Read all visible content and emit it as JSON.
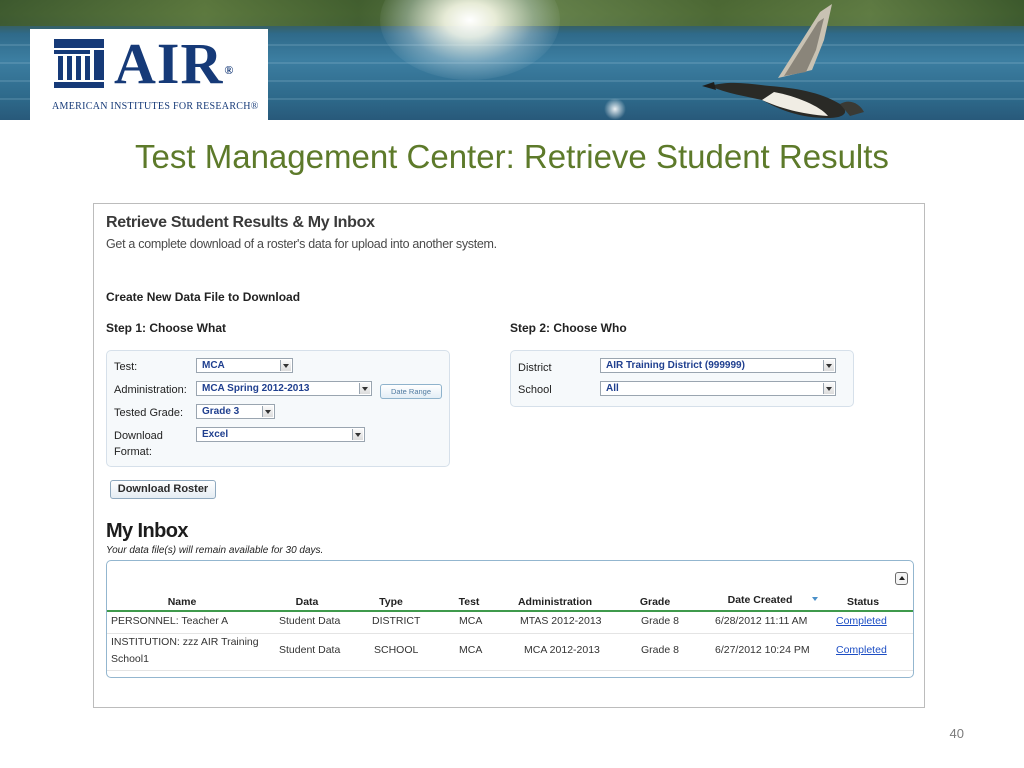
{
  "logo": {
    "wordmark": "AIR",
    "registered": "®",
    "subtitle": "AMERICAN INSTITUTES FOR RESEARCH®"
  },
  "slide": {
    "title": "Test Management Center: Retrieve Student Results",
    "page_number": "40"
  },
  "panel": {
    "heading": "Retrieve Student Results & My Inbox",
    "subheading": "Get a complete download of a roster's data for upload into another system.",
    "create_label": "Create New Data File to Download",
    "step1": {
      "title": "Step 1: Choose What",
      "test_label": "Test:",
      "test_value": "MCA",
      "admin_label": "Administration:",
      "admin_value": "MCA Spring 2012-2013",
      "date_range_button": "Date Range",
      "grade_label": "Tested Grade:",
      "grade_value": "Grade 3",
      "format_label_1": "Download",
      "format_label_2": "Format:",
      "format_value": "Excel"
    },
    "step2": {
      "title": "Step 2: Choose Who",
      "district_label": "District",
      "district_value": "AIR Training District (999999)",
      "school_label": "School",
      "school_value": "All"
    },
    "download_button": "Download Roster"
  },
  "inbox": {
    "title": "My Inbox",
    "note": "Your data file(s) will remain available for 30 days.",
    "columns": [
      "Name",
      "Data",
      "Type",
      "Test",
      "Administration",
      "Grade",
      "Date Created",
      "Status"
    ],
    "rows": [
      {
        "name_1": "PERSONNEL: Teacher A",
        "name_2": "",
        "data": "Student Data",
        "type": "DISTRICT",
        "test": "MCA",
        "administration": "MTAS 2012-2013",
        "grade": "Grade 8",
        "date_created": "6/28/2012 11:11 AM",
        "status": "Completed"
      },
      {
        "name_1": "INSTITUTION: zzz AIR Training",
        "name_2": "School1",
        "data": "Student Data",
        "type": "SCHOOL",
        "test": "MCA",
        "administration": "MCA 2012-2013",
        "grade": "Grade 8",
        "date_created": "6/27/2012 10:24 PM",
        "status": "Completed"
      }
    ]
  },
  "colors": {
    "title_green": "#5d7a2a",
    "logo_blue": "#163a78",
    "header_rule": "#3f9a4c",
    "link_blue": "#1d4ec4"
  }
}
